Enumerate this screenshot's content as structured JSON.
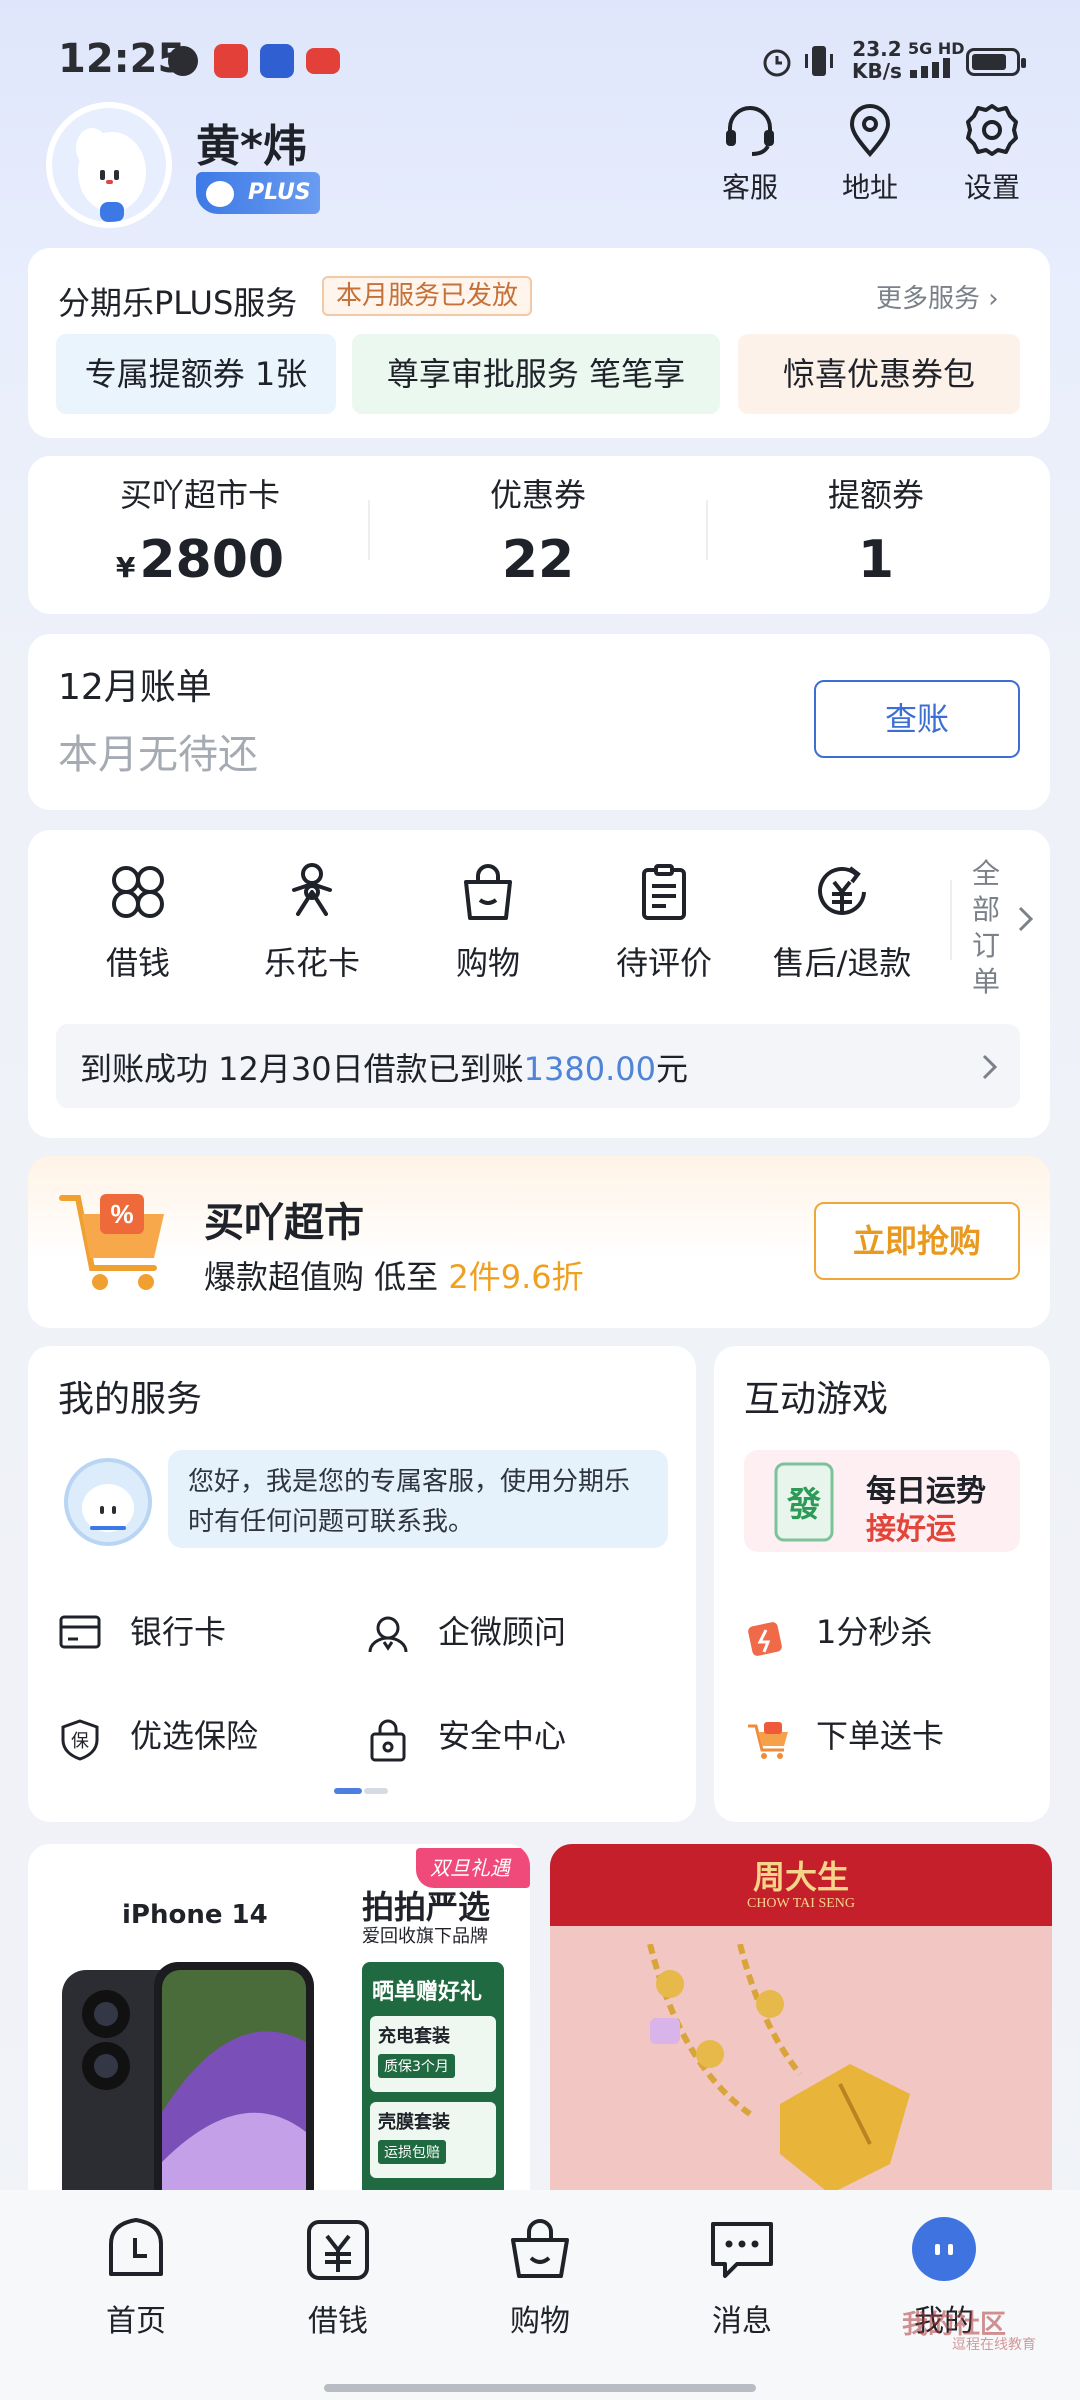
{
  "status_bar": {
    "time": "12:25",
    "net_speed_value": "23.2",
    "net_speed_unit": "KB/s",
    "net_type": "5G HD"
  },
  "profile": {
    "name": "黄*炜",
    "badge": "PLUS"
  },
  "top_actions": [
    {
      "label": "客服",
      "icon": "headset-icon"
    },
    {
      "label": "地址",
      "icon": "location-pin-icon"
    },
    {
      "label": "设置",
      "icon": "gear-icon"
    }
  ],
  "plus_service": {
    "title": "分期乐PLUS服务",
    "tag": "本月服务已发放",
    "more": "更多服务 ›",
    "perks": [
      "专属提额券 1张",
      "尊享审批服务 笔笔享",
      "惊喜优惠券包"
    ]
  },
  "stats": [
    {
      "label": "买吖超市卡",
      "currency": "¥",
      "value": "2800"
    },
    {
      "label": "优惠券",
      "value": "22"
    },
    {
      "label": "提额券",
      "value": "1"
    }
  ],
  "bill": {
    "title": "12月账单",
    "subtitle": "本月无待还",
    "button": "查账"
  },
  "quick_menu": {
    "items": [
      {
        "label": "借钱",
        "icon": "four-petal-icon"
      },
      {
        "label": "乐花卡",
        "icon": "flower-icon"
      },
      {
        "label": "购物",
        "icon": "shopping-bag-icon"
      },
      {
        "label": "待评价",
        "icon": "clipboard-icon"
      },
      {
        "label": "售后/退款",
        "icon": "refund-icon"
      }
    ],
    "all_orders": "全部订单"
  },
  "notice": {
    "prefix": "到账成功  12月30日借款已到账",
    "amount": "1380.00",
    "suffix": "元"
  },
  "market": {
    "title": "买吖超市",
    "subtitle": "爆款超值购 低至 ",
    "highlight": "2件9.6折",
    "button": "立即抢购"
  },
  "services": {
    "title": "我的服务",
    "greeting": "您好，我是您的专属客服，使用分期乐时有任何问题可联系我。",
    "items": [
      {
        "label": "银行卡",
        "icon": "bank-card-icon"
      },
      {
        "label": "企微顾问",
        "icon": "advisor-icon"
      },
      {
        "label": "优选保险",
        "icon": "insurance-shield-icon"
      },
      {
        "label": "安全中心",
        "icon": "lock-icon"
      }
    ]
  },
  "games": {
    "title": "互动游戏",
    "fortune_line1": "每日运势",
    "fortune_line2": "接好运",
    "fortune_tile": "發",
    "items": [
      {
        "label": "1分秒杀",
        "icon": "flash-sale-icon"
      },
      {
        "label": "下单送卡",
        "icon": "gift-cart-icon"
      }
    ]
  },
  "promos": {
    "phone_model": "iPhone 14",
    "phone_tag": "双旦礼遇季",
    "phone_headline": "拍拍严选",
    "phone_sub": "爱回收旗下品牌",
    "phone_gift_title": "晒单赠好礼",
    "phone_gift1": "充电套装",
    "phone_gift1_note": "质保3个月",
    "phone_gift2": "壳膜套装",
    "phone_gift2_note": "运损包赔",
    "jewelry_brand": "周大生",
    "jewelry_brand_en": "CHOW TAI SENG"
  },
  "bottom_nav": [
    {
      "label": "首页",
      "icon": "clock-home-icon"
    },
    {
      "label": "借钱",
      "icon": "yen-icon"
    },
    {
      "label": "购物",
      "icon": "shopping-bag-icon"
    },
    {
      "label": "消息",
      "icon": "chat-icon"
    },
    {
      "label": "我的",
      "icon": "profile-face-icon"
    }
  ],
  "watermark": {
    "text": "我的社区",
    "sub": "逗程在线教育"
  },
  "colors": {
    "accent_blue": "#3b6fd3",
    "amount_blue": "#4f84d8",
    "orange": "#f0a020",
    "red": "#e2463a"
  }
}
